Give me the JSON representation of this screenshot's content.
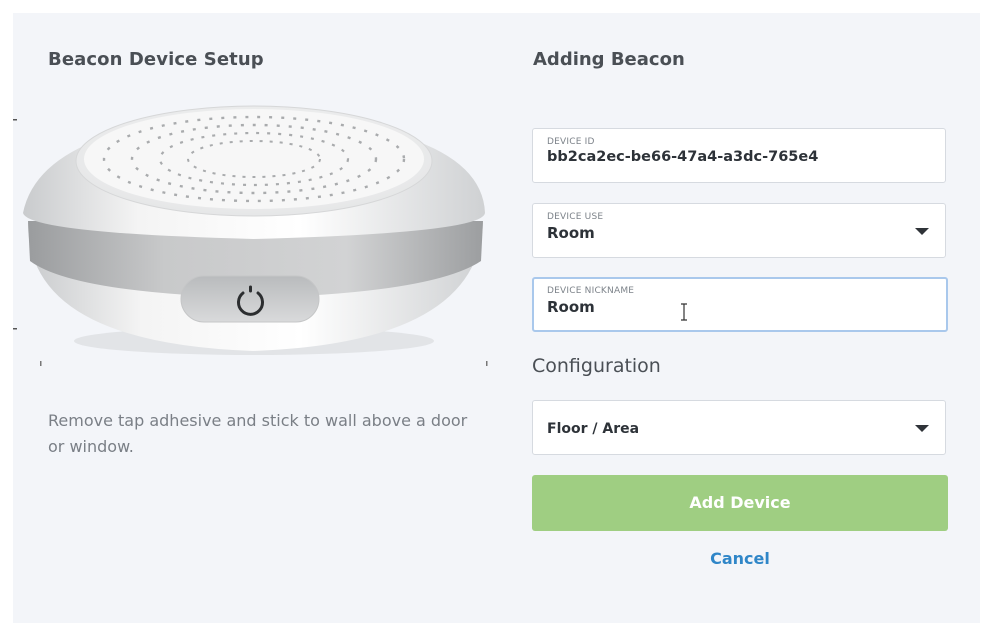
{
  "left": {
    "title": "Beacon Device Setup",
    "instructions": "Remove tap adhesive and stick to wall above a door or window."
  },
  "right": {
    "title": "Adding Beacon",
    "device_id": {
      "label": "DEVICE ID",
      "value": "bb2ca2ec-be66-47a4-a3dc-765e4"
    },
    "device_use": {
      "label": "DEVICE USE",
      "value": "Room"
    },
    "device_nickname": {
      "label": "DEVICE NICKNAME",
      "value": "Room"
    },
    "configuration_heading": "Configuration",
    "floor_area": {
      "value": "Floor / Area"
    },
    "add_device_label": "Add Device",
    "cancel_label": "Cancel"
  },
  "colors": {
    "panel_background": "#f3f5f9",
    "add_button": "#9fce82",
    "cancel_link": "#2f86c8",
    "focus_border": "#a9c8ec"
  },
  "icons": [
    "beacon-device-illustration",
    "power-icon",
    "chevron-down-icon",
    "text-cursor-icon"
  ]
}
